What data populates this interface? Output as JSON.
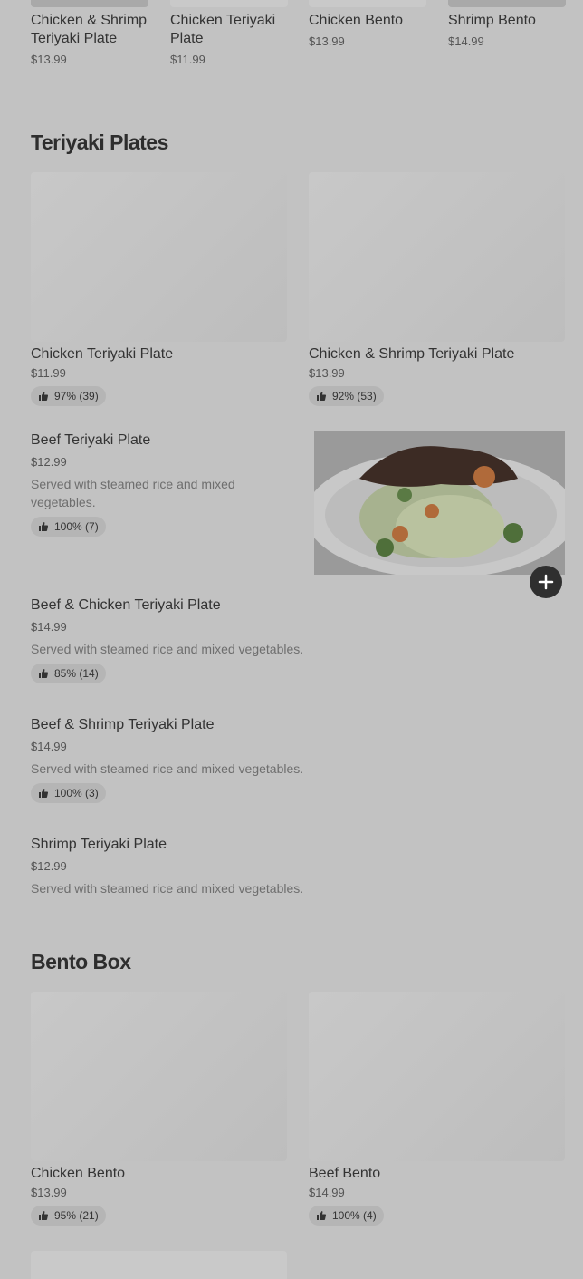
{
  "carousel": [
    {
      "name": "Chicken & Shrimp Teriyaki Plate",
      "price": "$13.99"
    },
    {
      "name": "Chicken Teriyaki Plate",
      "price": "$11.99"
    },
    {
      "name": "Chicken Bento",
      "price": "$13.99"
    },
    {
      "name": "Shrimp Bento",
      "price": "$14.99"
    }
  ],
  "teriyaki": {
    "title": "Teriyaki Plates",
    "featured": [
      {
        "name": "Chicken Teriyaki Plate",
        "price": "$11.99",
        "rating": "97% (39)"
      },
      {
        "name": "Chicken & Shrimp Teriyaki Plate",
        "price": "$13.99",
        "rating": "92% (53)"
      }
    ],
    "items": [
      {
        "name": "Beef Teriyaki Plate",
        "price": "$12.99",
        "desc": "Served with steamed rice and mixed vegetables.",
        "rating": "100% (7)"
      },
      {
        "name": "Beef & Chicken Teriyaki Plate",
        "price": "$14.99",
        "desc": "Served with steamed rice and mixed vegetables.",
        "rating": "85% (14)"
      },
      {
        "name": "Beef & Shrimp Teriyaki Plate",
        "price": "$14.99",
        "desc": "Served with steamed rice and mixed vegetables.",
        "rating": "100% (3)"
      },
      {
        "name": "Shrimp Teriyaki Plate",
        "price": "$12.99",
        "desc": "Served with steamed rice and mixed vegetables."
      }
    ]
  },
  "bento": {
    "title": "Bento Box",
    "featured": [
      {
        "name": "Chicken Bento",
        "price": "$13.99",
        "rating": "95% (21)"
      },
      {
        "name": "Beef Bento",
        "price": "$14.99",
        "rating": "100% (4)"
      }
    ]
  },
  "icons": {
    "rating": "thumbs-up-icon",
    "add": "plus-icon"
  },
  "colors": {
    "overlay": "#c2c2c2",
    "text": "#333333",
    "badge": "#b5b5b5"
  }
}
